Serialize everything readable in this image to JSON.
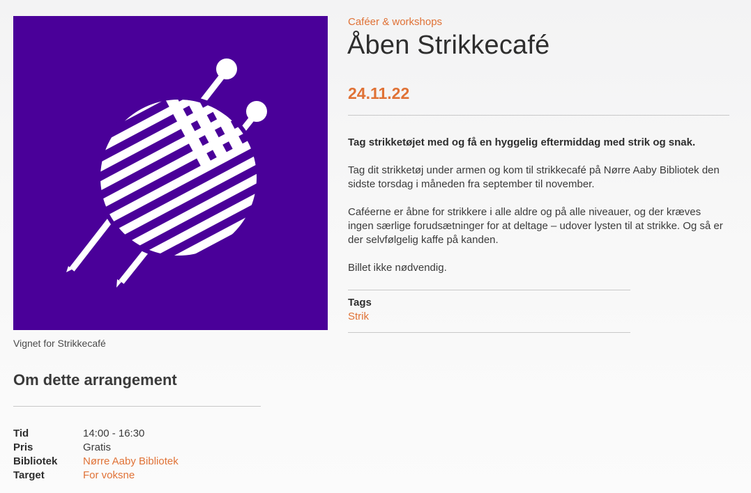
{
  "event": {
    "category": "Caféer & workshops",
    "title": "Åben Strikkecafé",
    "date": "24.11.22",
    "image_caption": "Vignet for Strikkecafé",
    "image_icon": "yarn-ball-knitting-needles-icon",
    "lead": "Tag strikketøjet med og få en hyggelig eftermiddag med strik og snak.",
    "paragraphs": [
      "Tag dit strikketøj under armen og kom til strikkecafé på Nørre Aaby Bibliotek den sidste torsdag i måneden fra september til november.",
      "Caféerne er åbne for strikkere i alle aldre og på alle niveauer, og der kræves ingen særlige forudsætninger for at deltage – udover lysten til at strikke. Og så er der selvfølgelig kaffe på kanden.",
      "Billet ikke nødvendig."
    ],
    "tags_label": "Tags",
    "tags": [
      "Strik"
    ]
  },
  "about": {
    "title": "Om dette arrangement",
    "rows": [
      {
        "key": "Tid",
        "value": "14:00 - 16:30"
      },
      {
        "key": "Pris",
        "value": "Gratis"
      },
      {
        "key": "Bibliotek",
        "value": "Nørre Aaby Bibliotek"
      },
      {
        "key": "Target",
        "value": "For voksne"
      }
    ]
  },
  "colors": {
    "accent": "#e07236",
    "image_bg": "#4a0099",
    "text": "#3a3a3a"
  }
}
